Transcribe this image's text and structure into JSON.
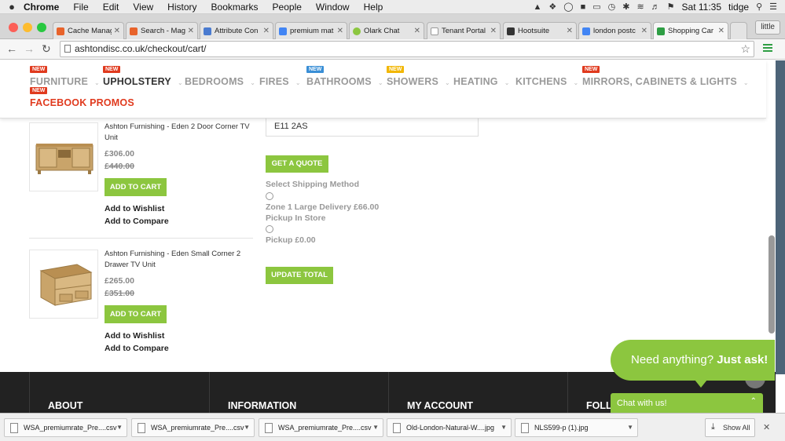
{
  "menubar": {
    "app": "Chrome",
    "items": [
      "File",
      "Edit",
      "View",
      "History",
      "Bookmarks",
      "People",
      "Window",
      "Help"
    ],
    "clock": "Sat 11:35",
    "user": "tidge"
  },
  "tabs": [
    {
      "title": "Cache Manag",
      "color": "#e8632b"
    },
    {
      "title": "Search - Mag",
      "color": "#e8632b"
    },
    {
      "title": "Attribute Con",
      "color": "#4a7bd0"
    },
    {
      "title": "premium mat",
      "color": "#4285f4"
    },
    {
      "title": "Olark Chat",
      "color": "#8cc63f"
    },
    {
      "title": "Tenant Portal",
      "color": "#999999"
    },
    {
      "title": "Hootsuite",
      "color": "#333333"
    },
    {
      "title": "london postc",
      "color": "#4285f4"
    },
    {
      "title": "Shopping Car",
      "color": "#2e9e44"
    }
  ],
  "profile": "little",
  "address": {
    "url": "ashtondisc.co.uk/checkout/cart/"
  },
  "nav": {
    "items": [
      {
        "label": "FURNITURE",
        "badge": "NEW",
        "badge_color": "#e03a1e"
      },
      {
        "label": "UPHOLSTERY",
        "badge": "NEW",
        "badge_color": "#e03a1e"
      },
      {
        "label": "BEDROOMS",
        "badge": "",
        "badge_color": ""
      },
      {
        "label": "FIRES",
        "badge": "",
        "badge_color": ""
      },
      {
        "label": "BATHROOMS",
        "badge": "NEW",
        "badge_color": "#3a8fd6"
      },
      {
        "label": "SHOWERS",
        "badge": "NEW",
        "badge_color": "#f2b705"
      },
      {
        "label": "HEATING",
        "badge": "",
        "badge_color": ""
      },
      {
        "label": "KITCHENS",
        "badge": "",
        "badge_color": ""
      },
      {
        "label": "MIRRORS, CABINETS & LIGHTS",
        "badge": "NEW",
        "badge_color": "#e03a1e"
      },
      {
        "label": "FACEBOOK PROMOS",
        "badge": "NEW",
        "badge_color": "#e03a1e"
      }
    ]
  },
  "products": [
    {
      "name": "Ashton Furnishing - Eden 2 Door Corner TV Unit",
      "price": "£306.00",
      "old_price": "£440.00",
      "add_to_cart": "ADD TO CART",
      "wishlist": "Add to Wishlist",
      "compare": "Add to Compare"
    },
    {
      "name": "Ashton Furnishing - Eden Small Corner 2 Drawer TV Unit",
      "price": "£265.00",
      "old_price": "£351.00",
      "add_to_cart": "ADD TO CART",
      "wishlist": "Add to Wishlist",
      "compare": "Add to Compare"
    }
  ],
  "shipping": {
    "postcode": "E11 2AS",
    "get_quote": "GET A QUOTE",
    "select_label": "Select Shipping Method",
    "options": [
      {
        "rate": "Zone 1 Large Delivery £66.00",
        "group": "Pickup In Store"
      },
      {
        "rate": "Pickup £0.00",
        "group": ""
      }
    ],
    "update_total": "UPDATE TOTAL"
  },
  "footer": {
    "headings": [
      "ABOUT",
      "INFORMATION",
      "MY ACCOUNT",
      "FOLL"
    ]
  },
  "chat": {
    "bubble_prefix": "Need anything?",
    "bubble_bold": "Just ask!",
    "bar_label": "Chat with us!"
  },
  "downloads": {
    "items": [
      "WSA_premiumrate_Pre....csv",
      "WSA_premiumrate_Pre....csv",
      "WSA_premiumrate_Pre....csv",
      "Old-London-Natural-W....jpg",
      "NLS599-p (1).jpg"
    ],
    "show_all": "Show All"
  },
  "colors": {
    "accent_green": "#8cc63f",
    "nav_red": "#e03a1e",
    "footer": "#222222"
  }
}
